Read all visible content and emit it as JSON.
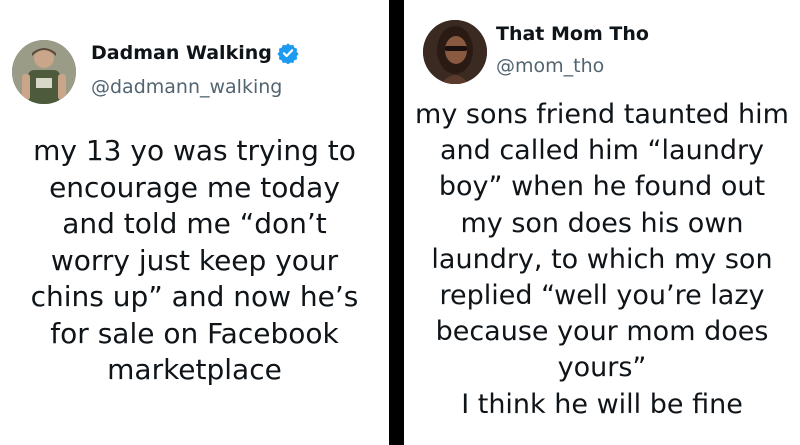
{
  "left_post": {
    "display_name": "Dadman Walking",
    "handle": "@dadmann_walking",
    "verified": true,
    "lines": [
      "my 13 yo was trying to",
      "encourage me today",
      "and told me “don’t",
      "worry just keep your",
      "chins up” and now he’s",
      "for sale on Facebook",
      "marketplace"
    ]
  },
  "right_post": {
    "display_name": "That Mom Tho",
    "handle": "@mom_tho",
    "lines": [
      "my sons friend taunted him",
      "and called him “laundry",
      "boy” when he found out",
      "my son does his own",
      "laundry, to which my son",
      "replied “well you’re lazy",
      "because your mom does",
      "yours”",
      "I think he will be fine"
    ]
  },
  "colors": {
    "background": "#000000",
    "card": "#ffffff",
    "text": "#0f1419",
    "handle": "#536471",
    "verified": "#1d9bf0"
  },
  "icons": {
    "verified": "verified-badge-icon"
  }
}
